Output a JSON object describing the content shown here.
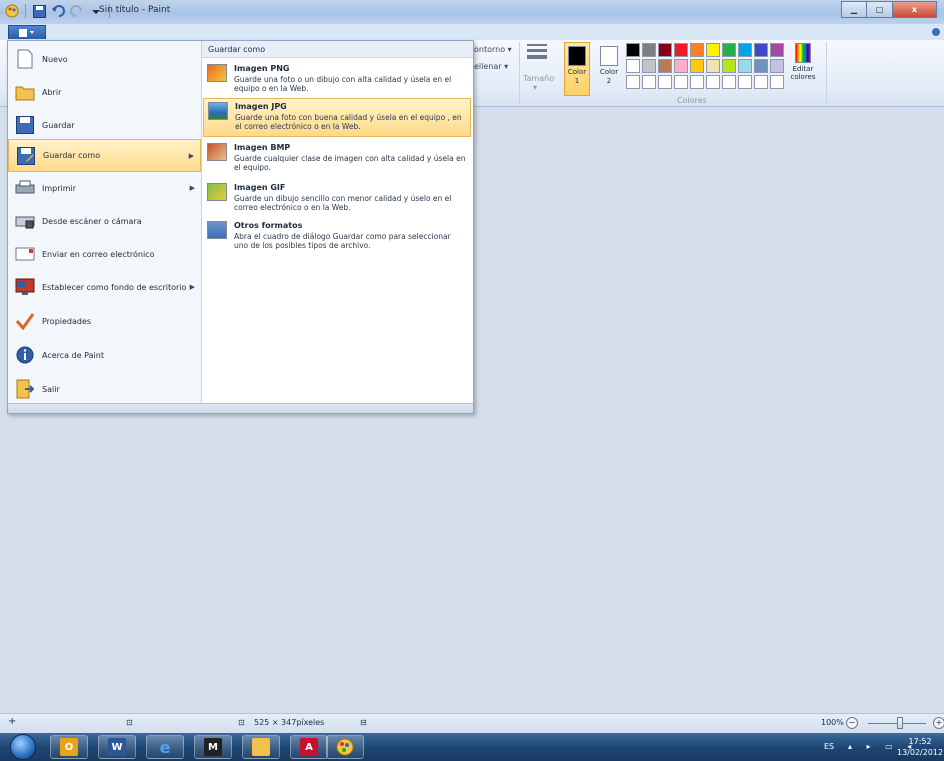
{
  "window": {
    "title": "Sin título - Paint",
    "minimize": "▁",
    "maximize": "□",
    "close": "x"
  },
  "ribbon": {
    "contorno": "ontorno ▾",
    "rellenar": "ellenar ▾",
    "tamano": "Tamaño",
    "color1": "Color 1",
    "color2": "Color 2",
    "editar_colores": "Editar colores",
    "colores_group": "Colores",
    "color1_value": "#000000",
    "color2_value": "#ffffff"
  },
  "palette": [
    "#000000",
    "#7f7f7f",
    "#880015",
    "#ed1c24",
    "#ff7f27",
    "#fff200",
    "#22b14c",
    "#00a2e8",
    "#3f48cc",
    "#a349a4",
    "#ffffff",
    "#c3c3c3",
    "#b97a57",
    "#ffaec9",
    "#ffc90e",
    "#efe4b0",
    "#b5e61d",
    "#99d9ea",
    "#7092be",
    "#c8bfe7",
    "#ffffff",
    "#ffffff",
    "#ffffff",
    "#ffffff",
    "#ffffff",
    "#ffffff",
    "#ffffff",
    "#ffffff",
    "#ffffff",
    "#ffffff"
  ],
  "file_menu": {
    "items": [
      {
        "label": "Nuevo",
        "icon": "new-document-icon",
        "submenu": false
      },
      {
        "label": "Abrir",
        "icon": "open-folder-icon",
        "submenu": false
      },
      {
        "label": "Guardar",
        "icon": "save-disk-icon",
        "submenu": false
      },
      {
        "label": "Guardar como",
        "icon": "save-as-icon",
        "submenu": true
      },
      {
        "label": "Imprimir",
        "icon": "printer-icon",
        "submenu": true
      },
      {
        "label": "Desde escáner o cámara",
        "icon": "scanner-icon",
        "submenu": false
      },
      {
        "label": "Enviar en correo electrónico",
        "icon": "email-icon",
        "submenu": false
      },
      {
        "label": "Establecer como fondo de escritorio",
        "icon": "desktop-background-icon",
        "submenu": true
      },
      {
        "label": "Propiedades",
        "icon": "checkmark-icon",
        "submenu": false
      },
      {
        "label": "Acerca de Paint",
        "icon": "info-icon",
        "submenu": false
      },
      {
        "label": "Salir",
        "icon": "exit-icon",
        "submenu": false
      }
    ],
    "submenu_title": "Guardar como",
    "save_as_options": [
      {
        "title": "Imagen PNG",
        "desc": "Guarde una foto o un dibujo con alta calidad y úsela en el equipo o en la Web."
      },
      {
        "title": "Imagen JPG",
        "desc": "Guarde una foto con buena calidad y úsela en el equipo , en el correo electrónico o en la Web."
      },
      {
        "title": "Imagen BMP",
        "desc": "Guarde cualquier clase de imagen con alta calidad y úsela en el equipo."
      },
      {
        "title": "Imagen GIF",
        "desc": "Guarde un dibujo sencillo con menor calidad y úselo en el correo electrónico o en la Web."
      },
      {
        "title": "Otros formatos",
        "desc": "Abra el cuadro de diálogo Guardar como para seleccionar uno de los posibles tipos de archivo."
      }
    ]
  },
  "statusbar": {
    "dimensions": "525 × 347píxeles",
    "zoom": "100%"
  },
  "taskbar": {
    "language": "ES",
    "time": "17:52",
    "date": "13/02/2012"
  }
}
